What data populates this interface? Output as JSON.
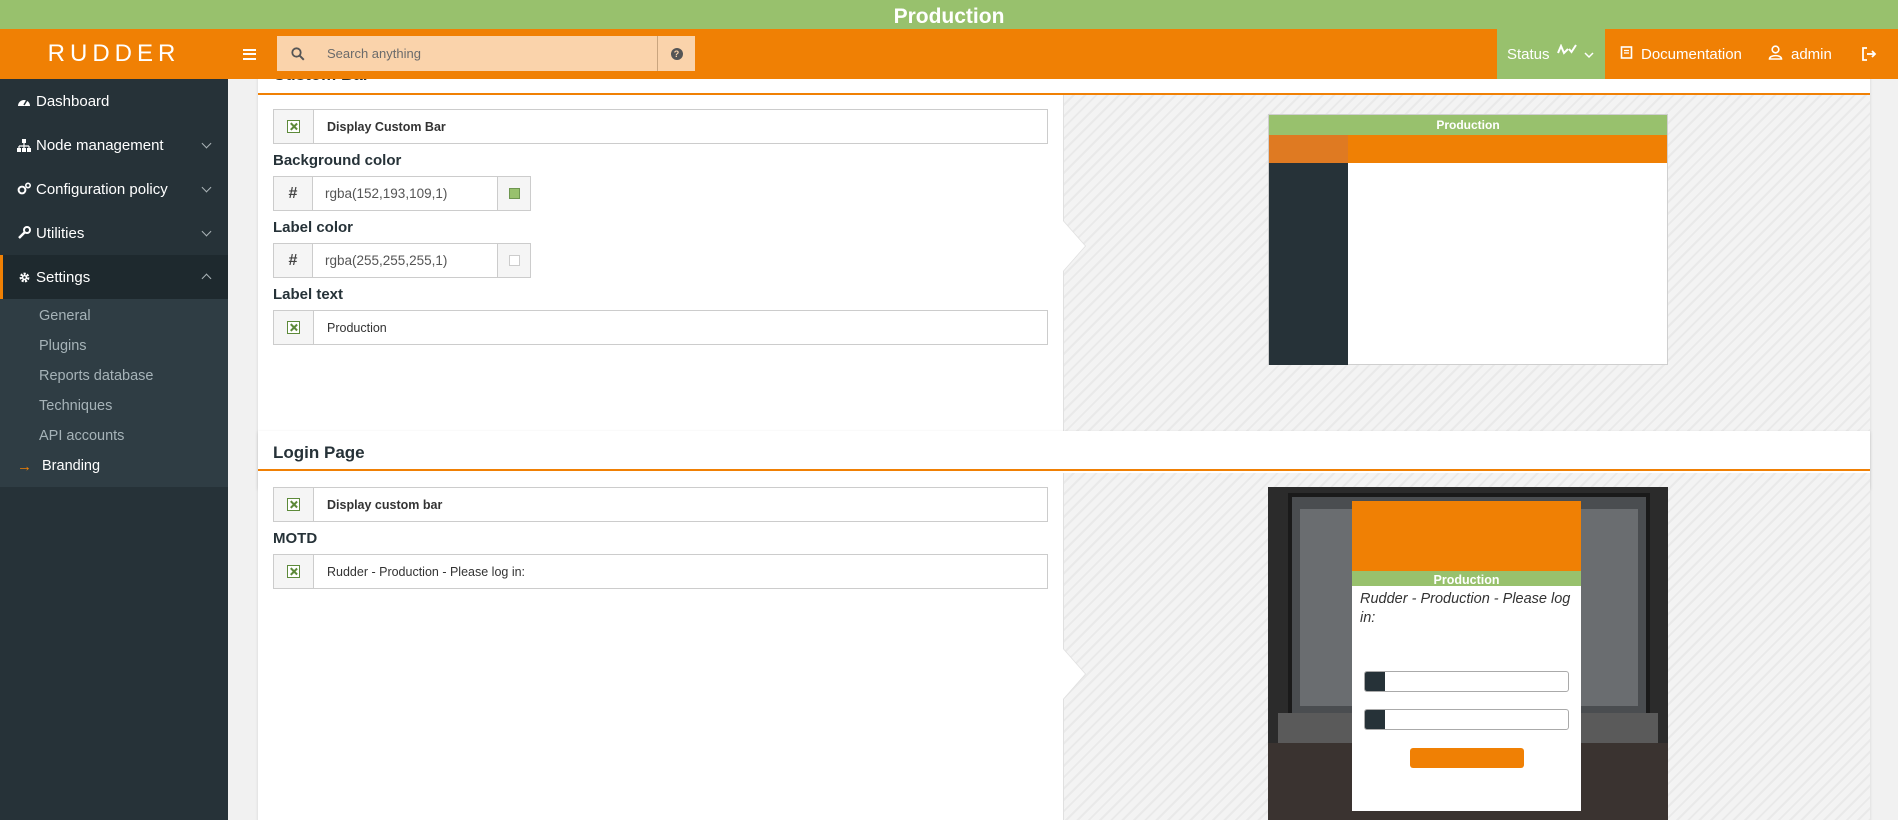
{
  "topbar": {
    "label": "Production"
  },
  "header": {
    "logo": "RUDDER",
    "search_placeholder": "Search anything",
    "status_label": "Status",
    "documentation_label": "Documentation",
    "user_label": "admin"
  },
  "sidebar": {
    "items": [
      {
        "label": "Dashboard",
        "icon": "dashboard-icon"
      },
      {
        "label": "Node management",
        "icon": "sitemap-icon"
      },
      {
        "label": "Configuration policy",
        "icon": "cogs-icon"
      },
      {
        "label": "Utilities",
        "icon": "wrench-icon"
      },
      {
        "label": "Settings",
        "icon": "gear-icon"
      }
    ],
    "settings_sub": [
      "General",
      "Plugins",
      "Reports database",
      "Techniques",
      "API accounts",
      "Branding"
    ]
  },
  "custom_bar": {
    "title": "Custom Bar",
    "display_label": "Display Custom Bar",
    "bg_color_label": "Background color",
    "bg_color_value": "rgba(152,193,109,1)",
    "label_color_label": "Label color",
    "label_color_value": "rgba(255,255,255,1)",
    "label_text_label": "Label text",
    "label_text_value": "Production",
    "preview_label": "Production"
  },
  "login_page": {
    "title": "Login Page",
    "display_label": "Display custom bar",
    "motd_label": "MOTD",
    "motd_value": "Rudder - Production - Please log in:",
    "preview_bar": "Production",
    "preview_motd": "Rudder - Production - Please log in:"
  },
  "colors": {
    "bar": "#98c16d",
    "accent": "#f08004",
    "sidebar": "#263238"
  }
}
